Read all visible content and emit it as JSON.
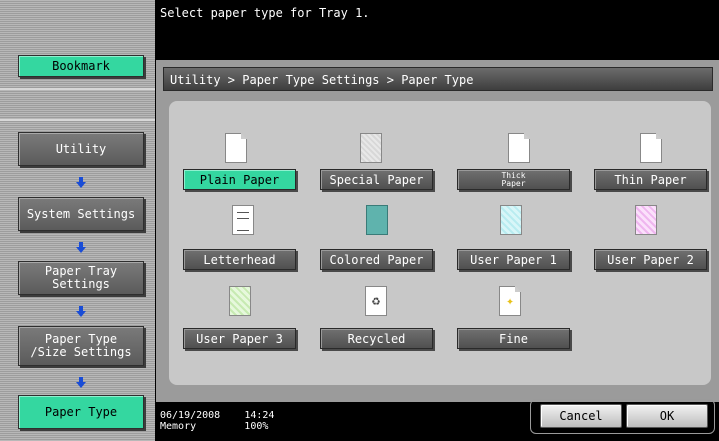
{
  "header": {
    "message": "Select paper type for Tray 1."
  },
  "sidebar": {
    "bookmark": "Bookmark",
    "items": [
      {
        "label": "Utility"
      },
      {
        "label": "System Settings"
      },
      {
        "label": "Paper Tray\nSettings"
      },
      {
        "label": "Paper Type\n/Size Settings"
      },
      {
        "label": "Paper Type"
      }
    ]
  },
  "panel": {
    "breadcrumb": "Utility > Paper Type Settings > Paper Type",
    "paper_types": [
      {
        "label": "Plain Paper",
        "icon": "plain-paper-icon",
        "selected": true
      },
      {
        "label": "Special Paper",
        "icon": "special-paper-icon",
        "selected": false
      },
      {
        "label": "Thick\nPaper",
        "icon": "thick-paper-icon",
        "selected": false
      },
      {
        "label": "Thin Paper",
        "icon": "thin-paper-icon",
        "selected": false
      },
      {
        "label": "Letterhead",
        "icon": "letterhead-icon",
        "selected": false
      },
      {
        "label": "Colored Paper",
        "icon": "colored-paper-icon",
        "selected": false
      },
      {
        "label": "User Paper 1",
        "icon": "user-paper-1-icon",
        "selected": false
      },
      {
        "label": "User Paper 2",
        "icon": "user-paper-2-icon",
        "selected": false
      },
      {
        "label": "User Paper 3",
        "icon": "user-paper-3-icon",
        "selected": false
      },
      {
        "label": "Recycled",
        "icon": "recycled-icon",
        "selected": false
      },
      {
        "label": "Fine",
        "icon": "fine-paper-icon",
        "selected": false
      }
    ]
  },
  "footer": {
    "date": "06/19/2008",
    "time": "14:24",
    "memory_label": "Memory",
    "memory_value": "100%",
    "cancel": "Cancel",
    "ok": "OK"
  },
  "colors": {
    "accent": "#34d7a0",
    "arrow": "#1a4dd6"
  }
}
